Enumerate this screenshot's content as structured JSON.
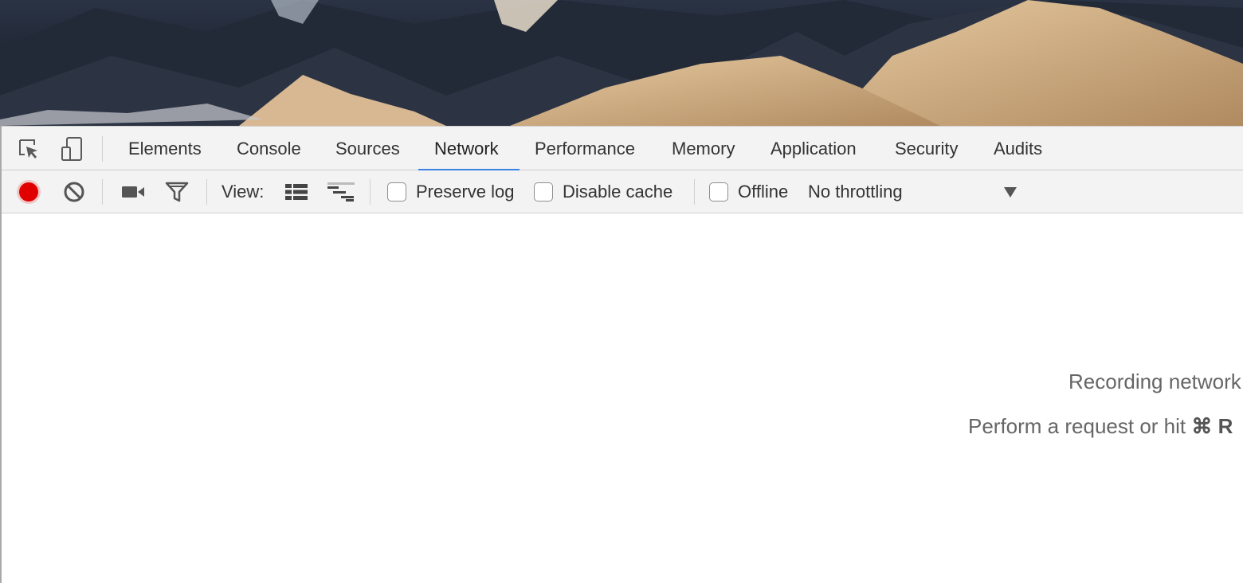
{
  "page": {
    "background_image": "mountain-landscape-photo"
  },
  "devtools": {
    "toolbar_icons": {
      "inspect": "inspect-element-icon",
      "device": "device-toolbar-icon"
    },
    "tabs": [
      {
        "label": "Elements",
        "active": false
      },
      {
        "label": "Console",
        "active": false
      },
      {
        "label": "Sources",
        "active": false
      },
      {
        "label": "Network",
        "active": true
      },
      {
        "label": "Performance",
        "active": false
      },
      {
        "label": "Memory",
        "active": false
      },
      {
        "label": "Application",
        "active": false
      },
      {
        "label": "Security",
        "active": false
      },
      {
        "label": "Audits",
        "active": false
      }
    ],
    "network_toolbar": {
      "record_color": "#e00000",
      "view_label": "View:",
      "preserve_log": {
        "label": "Preserve log",
        "checked": false
      },
      "disable_cache": {
        "label": "Disable cache",
        "checked": false
      },
      "offline": {
        "label": "Offline",
        "checked": false
      },
      "throttling": {
        "value": "No throttling"
      }
    },
    "empty_state": {
      "line1": "Recording network",
      "line2_prefix": "Perform a request or hit ",
      "line2_shortcut": "⌘ R"
    }
  },
  "colors": {
    "accent": "#3b82e6",
    "record": "#e00000",
    "panel_bg": "#f3f3f3"
  }
}
